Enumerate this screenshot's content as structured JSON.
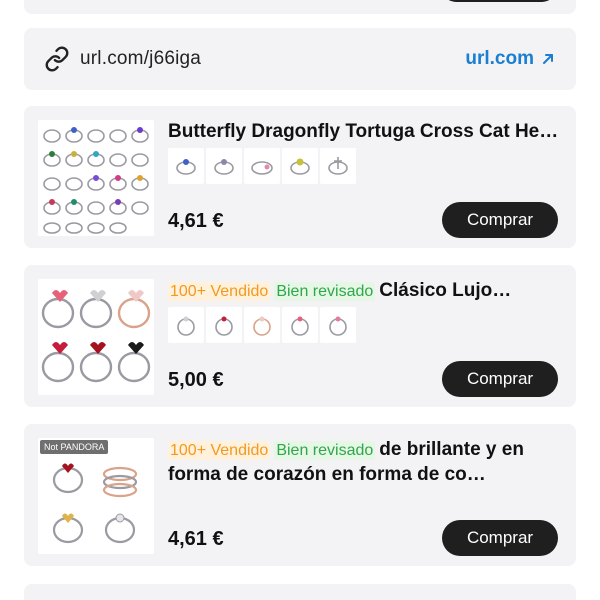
{
  "link_bar": {
    "url_text": "url.com/j66iga",
    "open_label": "url.com"
  },
  "products": [
    {
      "title": "Butterfly Dragonfly Tortuga Cross Cat Heart Rings",
      "price": "4,61 €",
      "buy_label": "Comprar"
    },
    {
      "tag_sold": "100+ Vendido",
      "tag_review": "Bien revisado",
      "title": "Clásico Lujo…",
      "price": "5,00 €",
      "buy_label": "Comprar"
    },
    {
      "badge": "Not PANDORA",
      "tag_sold": "100+ Vendido",
      "tag_review": "Bien revisado",
      "title": "de brillante y en forma de corazón en forma de co…",
      "price": "4,61 €",
      "buy_label": "Comprar"
    }
  ],
  "colors": {
    "accent_link": "#1a7fd1",
    "button_bg": "#1f1f1f",
    "card_bg": "#f3f3f5",
    "tag_sold_text": "#f39a1e",
    "tag_review_text": "#2ea84a"
  }
}
